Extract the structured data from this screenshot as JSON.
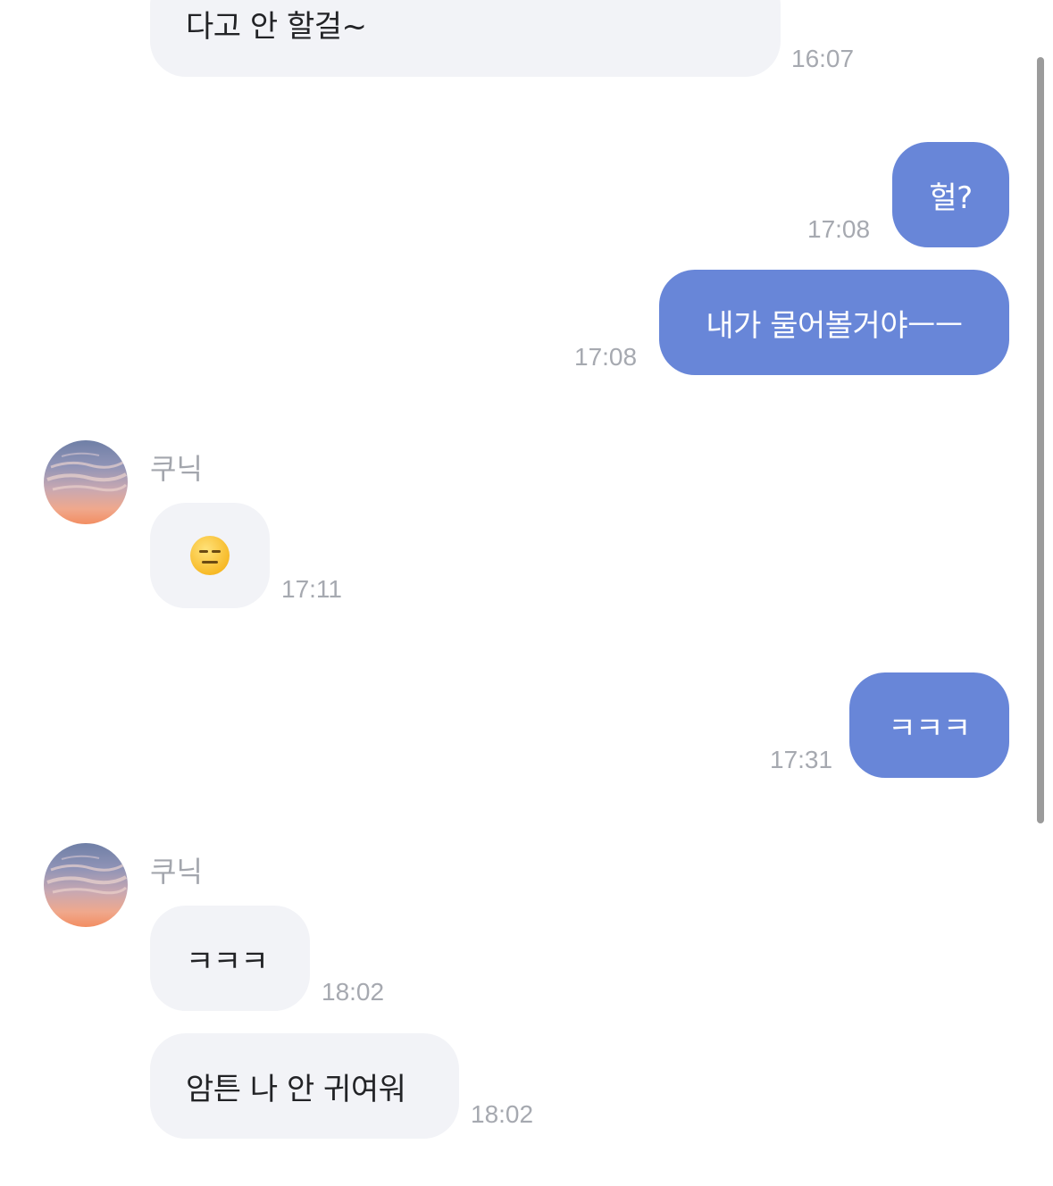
{
  "messages": [
    {
      "type": "incoming",
      "text": "다고 안 할걸~",
      "time": "16:07"
    },
    {
      "type": "outgoing",
      "text": "헐?",
      "time": "17:08"
    },
    {
      "type": "outgoing",
      "text": "내가 물어볼거야ㅡㅡ",
      "time": "17:08"
    },
    {
      "type": "incoming",
      "sender": "쿠닉",
      "emoji": "expressionless-face",
      "time": "17:11"
    },
    {
      "type": "outgoing",
      "text": "ㅋㅋㅋ",
      "time": "17:31"
    },
    {
      "type": "incoming",
      "sender": "쿠닉",
      "text": "ㅋㅋㅋ",
      "time": "18:02"
    },
    {
      "type": "incoming",
      "text": "암튼 나 안 귀여워",
      "time": "18:02"
    }
  ],
  "colors": {
    "outgoing_bubble": "#6886d8",
    "incoming_bubble": "#f2f3f7",
    "timestamp": "#a6a9b0",
    "sender_name": "#a3a6ad"
  }
}
